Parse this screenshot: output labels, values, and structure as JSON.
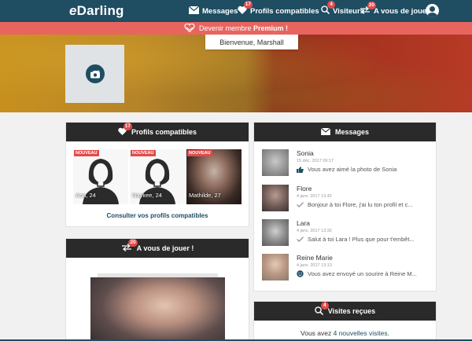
{
  "nav": {
    "logo_prefix": "e",
    "logo_rest": "Darling",
    "items": [
      {
        "label": "Messages",
        "badge": ""
      },
      {
        "label": "Profils compatibles",
        "badge": "17"
      },
      {
        "label": "Visiteurs",
        "badge": "4"
      },
      {
        "label": "A vous de jouer !",
        "badge": "20"
      }
    ]
  },
  "premium": {
    "text": "Devenir membre ",
    "bold": "Premium !"
  },
  "welcome": "Bienvenue, Marshall",
  "compat_card": {
    "title": "Profils compatibles",
    "badge": "17",
    "profiles": [
      {
        "tag": "NOUVEAU",
        "name": "Ana, 24",
        "kind": "silhouette"
      },
      {
        "tag": "NOUVEAU",
        "name": "Naykee, 24",
        "kind": "silhouette"
      },
      {
        "tag": "NOUVEAU",
        "name": "Mathilde, 27",
        "kind": "photo"
      }
    ],
    "link": "Consulter vos profils compatibles"
  },
  "play_card": {
    "title": "A vous de jouer !",
    "badge": "20"
  },
  "messages_card": {
    "title": "Messages",
    "items": [
      {
        "name": "Sonia",
        "date": "15 déc. 2017 09:17",
        "text": "Vous avez aimé la photo de Sonia",
        "status": "thumb-up"
      },
      {
        "name": "Flore",
        "date": "4 janv. 2017 13:42",
        "text": "Bonjour à toi Flore, j'ai lu ton profil et c...",
        "status": "check"
      },
      {
        "name": "Lara",
        "date": "4 janv. 2017 13:32",
        "text": "Salut à toi Lara ! Plus que pour t'embêt...",
        "status": "check"
      },
      {
        "name": "Reine Marie",
        "date": "4 janv. 2017 13:13",
        "text": "Vous avez envoyé un sourire à Reine M...",
        "status": "smile"
      }
    ]
  },
  "visits_card": {
    "title": "Visites reçues",
    "badge": "4",
    "text_before": "Vous avez ",
    "link": "4 nouvelles visites",
    "text_after": "."
  },
  "colors": {
    "navy": "#1f4d62",
    "coral": "#e8655f",
    "badge_red": "#e24b4b",
    "dark_header": "#2a2a2a"
  }
}
